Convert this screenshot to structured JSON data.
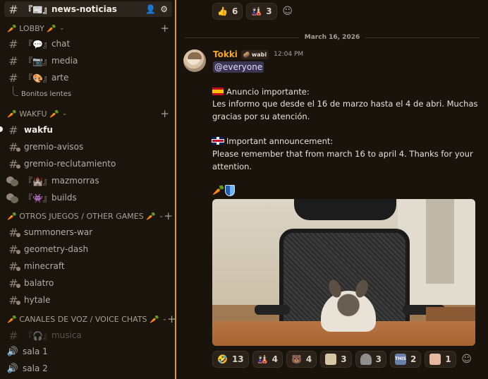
{
  "sidebar": {
    "top_channel": {
      "prefix": "『📰』",
      "name": "news-noticias"
    },
    "categories": [
      {
        "label": "🥕 LOBBY 🥕"
      },
      {
        "label": "🥕 WAKFU 🥕"
      },
      {
        "label": "🥕 OTROS JUEGOS / OTHER GAMES 🥕"
      },
      {
        "label": "🥕 CANALES DE VOZ / VOICE CHATS 🥕"
      }
    ],
    "channels": [
      {
        "prefix": "『💬』",
        "name": "chat"
      },
      {
        "prefix": "『📷』",
        "name": "media"
      },
      {
        "prefix": "『🎨』",
        "name": "arte"
      },
      {
        "prefix": "",
        "name": "Bonitos lentes"
      },
      {
        "prefix": "",
        "name": "wakfu"
      },
      {
        "prefix": "",
        "name": "gremio-avisos"
      },
      {
        "prefix": "",
        "name": "gremio-reclutamiento"
      },
      {
        "prefix": "『🏰』",
        "name": "mazmorras"
      },
      {
        "prefix": "『👾』",
        "name": "builds"
      },
      {
        "prefix": "",
        "name": "summoners-war"
      },
      {
        "prefix": "",
        "name": "geometry-dash"
      },
      {
        "prefix": "",
        "name": "minecraft"
      },
      {
        "prefix": "",
        "name": "balatro"
      },
      {
        "prefix": "",
        "name": "hytale"
      },
      {
        "prefix": "『🎧』",
        "name": "musica"
      },
      {
        "prefix": "",
        "name": "sala 1"
      },
      {
        "prefix": "",
        "name": "sala 2"
      }
    ]
  },
  "main": {
    "top_reactions": [
      {
        "emoji": "👍",
        "count": "6"
      },
      {
        "emoji": "🎎",
        "count": "3"
      }
    ],
    "date_separator": "March 16, 2026",
    "message": {
      "author": "Tokki",
      "tag": "wabi",
      "tag_emoji": "🥔",
      "time": "12:04 PM",
      "mention": "@everyone",
      "es_title": "Anuncio importante:",
      "es_body": "Les informo que desde el 16 de marzo hasta el 4 de abri. Muchas gracias por su atención.",
      "en_title": "Important announcement:",
      "en_body": "Please remember that from march 16 to april 4. Thanks for your attention.",
      "emoji_line": "🥕"
    },
    "bottom_reactions": [
      {
        "emoji": "🤣",
        "count": "13",
        "color": "#f5c542"
      },
      {
        "emoji": "🎎",
        "count": "4",
        "color": "#c0392b"
      },
      {
        "emoji": "🐻",
        "count": "4",
        "color": "#b87333"
      },
      {
        "emoji": "",
        "count": "3",
        "color": "#d9c7a3"
      },
      {
        "emoji": "",
        "count": "3",
        "color": "#8f8f8f"
      },
      {
        "emoji": "",
        "count": "2",
        "color": "#6a7fa8",
        "label": "THIS"
      },
      {
        "emoji": "",
        "count": "1",
        "color": "#e6b8a0"
      }
    ]
  }
}
